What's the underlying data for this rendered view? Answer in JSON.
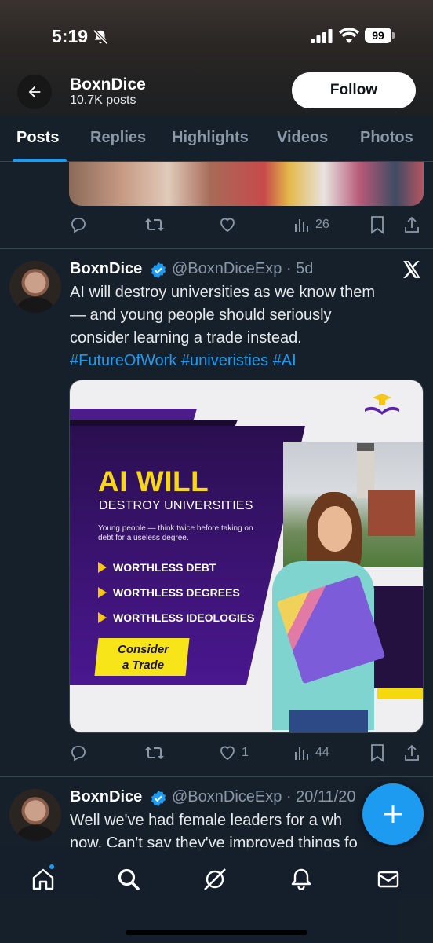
{
  "status_bar": {
    "time": "5:19",
    "battery": "99"
  },
  "header": {
    "name": "BoxnDice",
    "posts_count": "10.7K posts",
    "follow_label": "Follow"
  },
  "tabs": [
    {
      "label": "Posts",
      "active": true
    },
    {
      "label": "Replies"
    },
    {
      "label": "Highlights"
    },
    {
      "label": "Videos"
    },
    {
      "label": "Photos"
    }
  ],
  "prev_post": {
    "views": "26"
  },
  "tweet": {
    "name": "BoxnDice",
    "handle_date": "@BoxnDiceExp · 5d",
    "text_line1": "AI will destroy universities as we know them",
    "text_line2": "— and young people should seriously",
    "text_line3": "consider learning a trade instead.",
    "hashtags": "#FutureOfWork #univeristies #AI",
    "likes": "1",
    "views": "44",
    "media": {
      "title": "AI WILL",
      "subtitle": "DESTROY UNIVERSITIES",
      "small_text": "Young people — think twice before taking on debt for a useless degree.",
      "bullets": [
        "WORTHLESS DEBT",
        "WORTHLESS DEGREES",
        "WORTHLESS IDEOLOGIES"
      ],
      "cta_line1": "Consider",
      "cta_line2": "a Trade"
    }
  },
  "next_tweet": {
    "name": "BoxnDice",
    "handle_date": "@BoxnDiceExp · 20/11/20",
    "text_line1": "Well we've had female leaders for a wh",
    "text_line2": "now. Can't say they've improved things fo"
  },
  "colors": {
    "accent": "#1d9bf0",
    "background": "#15202b",
    "muted": "#8b98a5",
    "media_purple": "#4a1790",
    "media_yellow": "#f7d716"
  },
  "icons": [
    "back-arrow-icon",
    "bell-off-icon",
    "signal-icon",
    "wifi-icon",
    "battery-icon",
    "reply-icon",
    "retweet-icon",
    "like-icon",
    "views-icon",
    "bookmark-icon",
    "share-icon",
    "verified-icon",
    "x-logo-icon",
    "plus-icon",
    "home-icon",
    "search-icon",
    "grok-icon",
    "notifications-icon",
    "messages-icon"
  ]
}
